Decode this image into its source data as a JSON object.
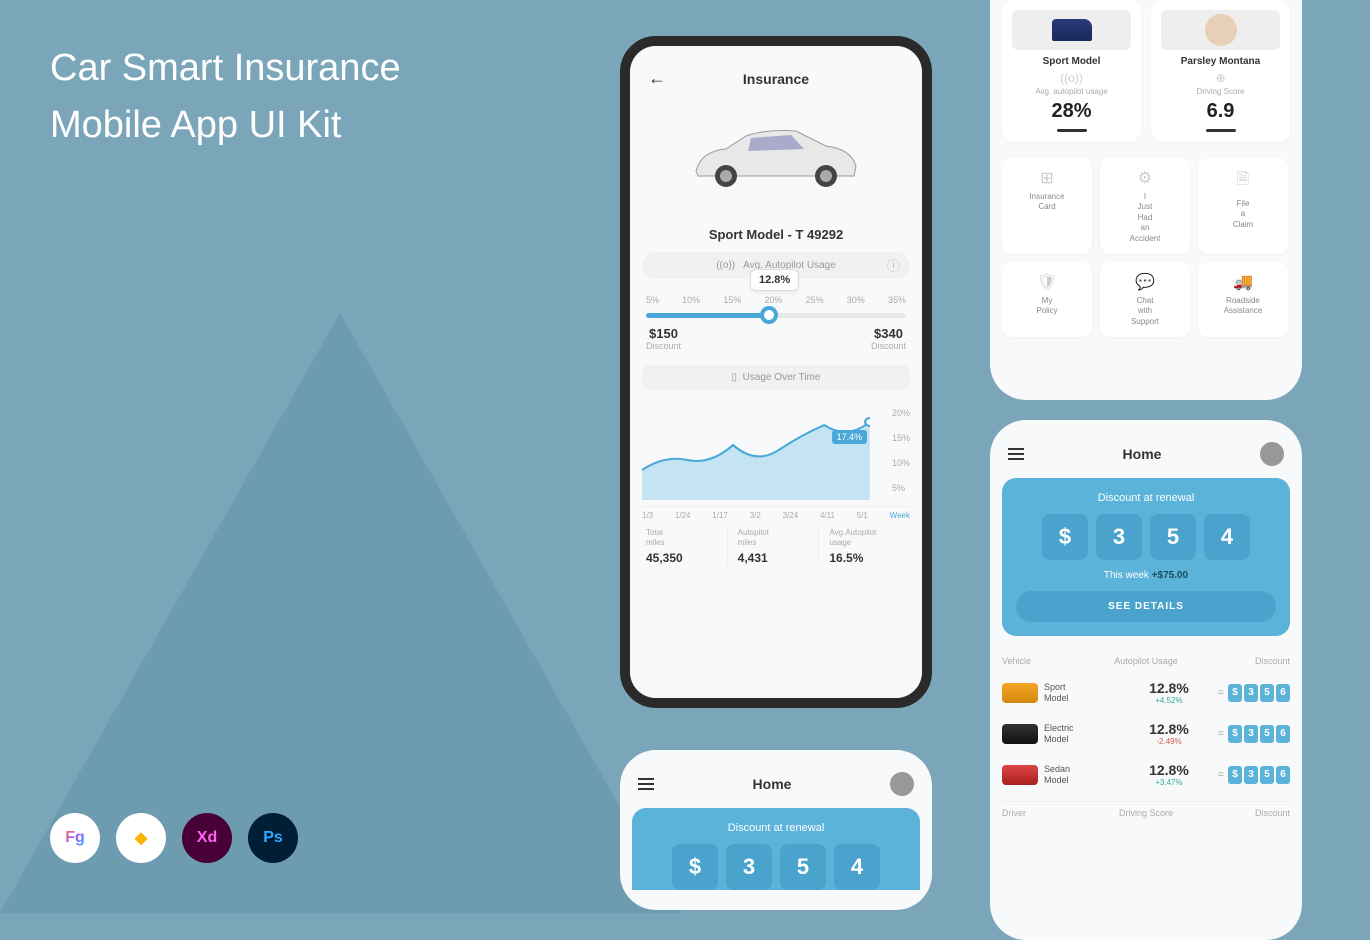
{
  "page": {
    "title_line1": "Car Smart Insurance",
    "title_line2": "Mobile App UI Kit"
  },
  "platforms": [
    "Fg",
    "◆",
    "Xd",
    "Ps"
  ],
  "screen1": {
    "title": "Insurance",
    "model": "Sport Model - T 49292",
    "autopilot_label": "Avg. Autopilot Usage",
    "slider_value": "12.8%",
    "ticks": [
      "5%",
      "10%",
      "15%",
      "20%",
      "25%",
      "30%",
      "35%"
    ],
    "min": {
      "value": "$150",
      "label": "Discount"
    },
    "max": {
      "value": "$340",
      "label": "Discount"
    },
    "usage_over_time": "Usage Over Time",
    "point_value": "17.4%",
    "ylabels": [
      "20%",
      "15%",
      "10%",
      "5%"
    ],
    "xaxis": [
      "1/3",
      "1/24",
      "1/17",
      "3/2",
      "3/24",
      "4/11",
      "5/1",
      "Week"
    ],
    "stats": [
      {
        "label": "Total miles",
        "value": "45,350"
      },
      {
        "label": "Autopilot miles",
        "value": "4,431"
      },
      {
        "label": "Avg.Autopilot usage",
        "value": "16.5%"
      }
    ]
  },
  "screen2": {
    "title": "Home",
    "discount_title": "Discount at renewal",
    "digits": [
      "$",
      "3",
      "5",
      "4"
    ]
  },
  "screen3": {
    "cards": [
      {
        "name": "Sport Model",
        "sub": "Avg. autopilot usage",
        "value": "28%"
      },
      {
        "name": "Parsley Montana",
        "sub": "Driving Score",
        "value": "6.9"
      }
    ],
    "actions": [
      {
        "icon": "⊞",
        "label": "Insurance Card"
      },
      {
        "icon": "⚙",
        "label": "I Just Had an Accident"
      },
      {
        "icon": "🗎",
        "label": "File a Claim"
      },
      {
        "icon": "🛡",
        "label": "My Policy"
      },
      {
        "icon": "💬",
        "label": "Chat with Support"
      },
      {
        "icon": "🚚",
        "label": "Roadside Assistance"
      }
    ]
  },
  "screen4": {
    "title": "Home",
    "discount_title": "Discount at renewal",
    "digits": [
      "$",
      "3",
      "5",
      "4"
    ],
    "week_label": "This week",
    "week_amount": "+$75.00",
    "details_btn": "SEE DETAILS",
    "cols": {
      "v": "Vehicle",
      "a": "Autopilot Usage",
      "d": "Discount"
    },
    "rows": [
      {
        "name": "Sport Model",
        "pct": "12.8%",
        "delta": "+4.52%",
        "cls": "pos",
        "d": [
          "$",
          "3",
          "5",
          "6"
        ]
      },
      {
        "name": "Electric Model",
        "pct": "12.8%",
        "delta": "-2.49%",
        "cls": "neg",
        "d": [
          "$",
          "3",
          "5",
          "6"
        ]
      },
      {
        "name": "Sedan Model",
        "pct": "12.8%",
        "delta": "+3.47%",
        "cls": "pos",
        "d": [
          "$",
          "3",
          "5",
          "6"
        ]
      }
    ],
    "footer_cols": {
      "a": "Driver",
      "b": "Driving Score",
      "c": "Discount"
    }
  },
  "chart_data": {
    "type": "area",
    "x": [
      "1/3",
      "1/24",
      "1/17",
      "3/2",
      "3/24",
      "4/11",
      "5/1"
    ],
    "values": [
      8,
      11,
      7,
      13,
      10,
      17,
      14,
      17.4
    ],
    "ylabel": "Usage %",
    "ylim": [
      5,
      20
    ],
    "highlighted_point": {
      "x": "5/1",
      "value": 17.4
    }
  }
}
